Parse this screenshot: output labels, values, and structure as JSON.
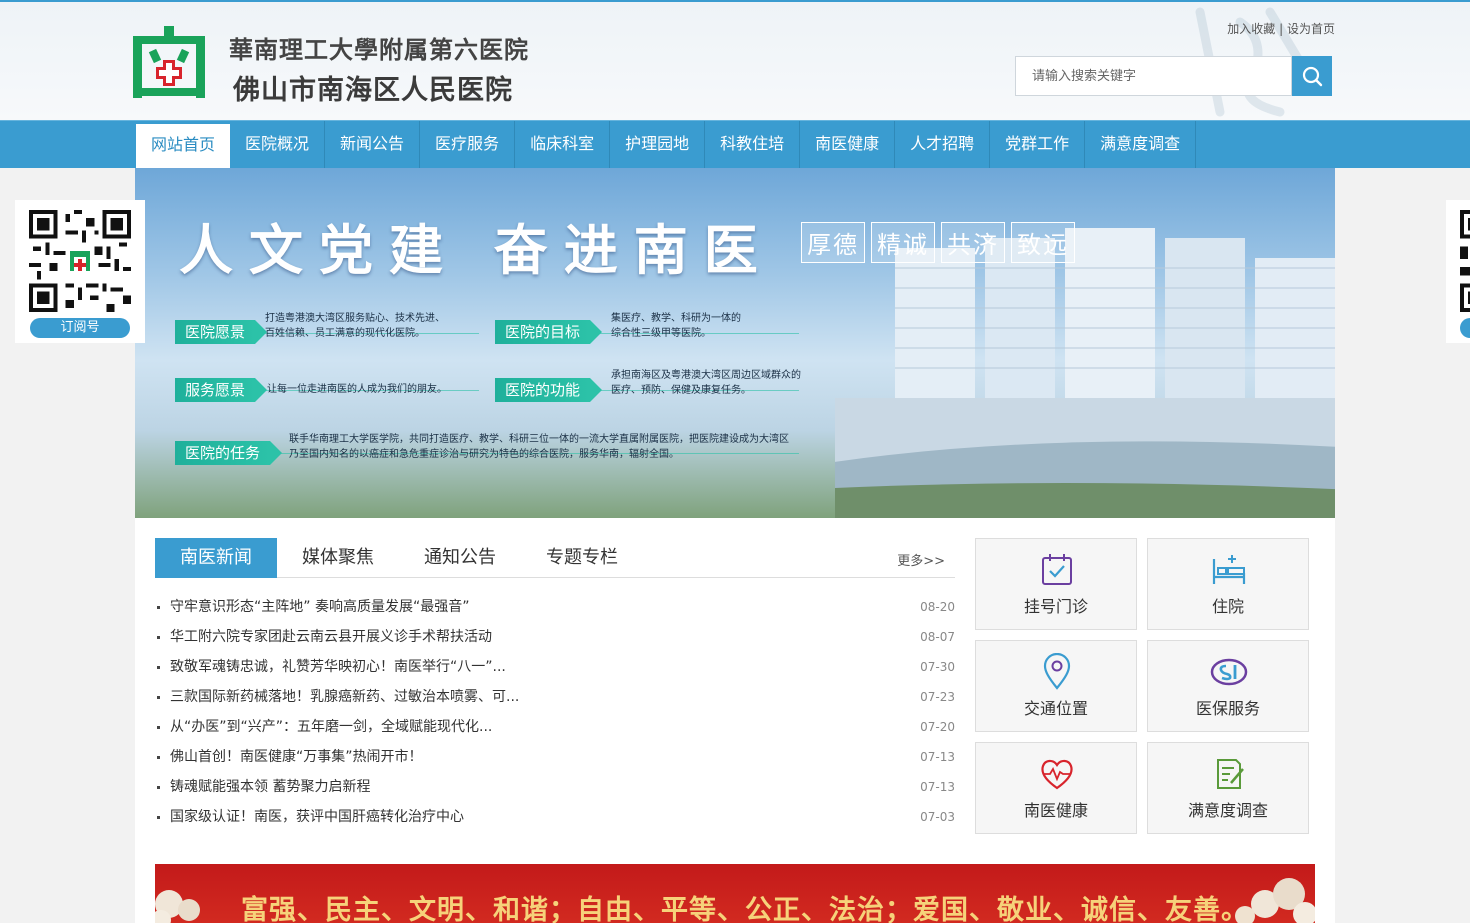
{
  "header": {
    "logo_line1": "華南理工大學附属第六医院",
    "logo_line2": "佛山市南海区人民医院",
    "links": [
      "加入收藏",
      "设为首页"
    ],
    "link_sep": "|",
    "search_placeholder": "请输入搜索关键字"
  },
  "nav": [
    "网站首页",
    "医院概况",
    "新闻公告",
    "医疗服务",
    "临床科室",
    "护理园地",
    "科教住培",
    "南医健康",
    "人才招聘",
    "党群工作",
    "满意度调查"
  ],
  "banner": {
    "slogan": "人文党建 奋进南医",
    "tags": [
      "厚德",
      "精诚",
      "共济",
      "致远"
    ],
    "sections": [
      {
        "label": "医院愿景",
        "text": [
          "打造粤港澳大湾区服务贴心、技术先进、",
          "百姓信赖、员工满意的现代化医院。"
        ]
      },
      {
        "label": "医院的目标",
        "text": [
          "集医疗、教学、科研为一体的",
          "综合性三级甲等医院。"
        ]
      },
      {
        "label": "服务愿景",
        "text": [
          "让每一位走进南医的人成为我们的朋友。"
        ]
      },
      {
        "label": "医院的功能",
        "text": [
          "承担南海区及粤港澳大湾区周边区域群众的",
          "医疗、预防、保健及康复任务。"
        ]
      },
      {
        "label": "医院的任务",
        "text": [
          "联手华南理工大学医学院，共同打造医疗、教学、科研三位一体的一流大学直属附属医院，把医院建设成为大湾区",
          "乃至国内知名的以癌症和急危重症诊治与研究为特色的综合医院，服务华南，辐射全国。"
        ]
      }
    ]
  },
  "float_qr": {
    "label": "订阅号"
  },
  "tabs": [
    "南医新闻",
    "媒体聚焦",
    "通知公告",
    "专题专栏"
  ],
  "more": "更多>>",
  "news": [
    {
      "title": "守牢意识形态“主阵地” 奏响高质量发展“最强音”",
      "date": "08-20"
    },
    {
      "title": "华工附六院专家团赴云南云县开展义诊手术帮扶活动",
      "date": "08-07"
    },
    {
      "title": "致敬军魂铸忠诚，礼赞芳华映初心！南医举行“八一”...",
      "date": "07-30"
    },
    {
      "title": "三款国际新药械落地！乳腺癌新药、过敏治本喷雾、可...",
      "date": "07-23"
    },
    {
      "title": "从“办医”到“兴产”：五年磨一剑，全域赋能现代化...",
      "date": "07-20"
    },
    {
      "title": "佛山首创！南医健康“万事集”热闹开市！",
      "date": "07-13"
    },
    {
      "title": "铸魂赋能强本领 蓄势聚力启新程",
      "date": "07-13"
    },
    {
      "title": "国家级认证！南医，获评中国肝癌转化治疗中心",
      "date": "07-03"
    }
  ],
  "quick": [
    {
      "label": "挂号门诊",
      "icon": "calendar-check-icon"
    },
    {
      "label": "住院",
      "icon": "hospital-bed-icon"
    },
    {
      "label": "交通位置",
      "icon": "map-pin-icon"
    },
    {
      "label": "医保服务",
      "icon": "medical-insurance-icon"
    },
    {
      "label": "南医健康",
      "icon": "heart-pulse-icon"
    },
    {
      "label": "满意度调查",
      "icon": "survey-edit-icon"
    }
  ],
  "values_banner": "富强、民主、文明、和谐；自由、平等、公正、法治；爱国、敬业、诚信、友善。",
  "colors": {
    "primary": "#3a9cd0",
    "logo_green": "#1aa35a",
    "logo_red": "#d8242c",
    "quick_icon": "#6b3fa0"
  }
}
